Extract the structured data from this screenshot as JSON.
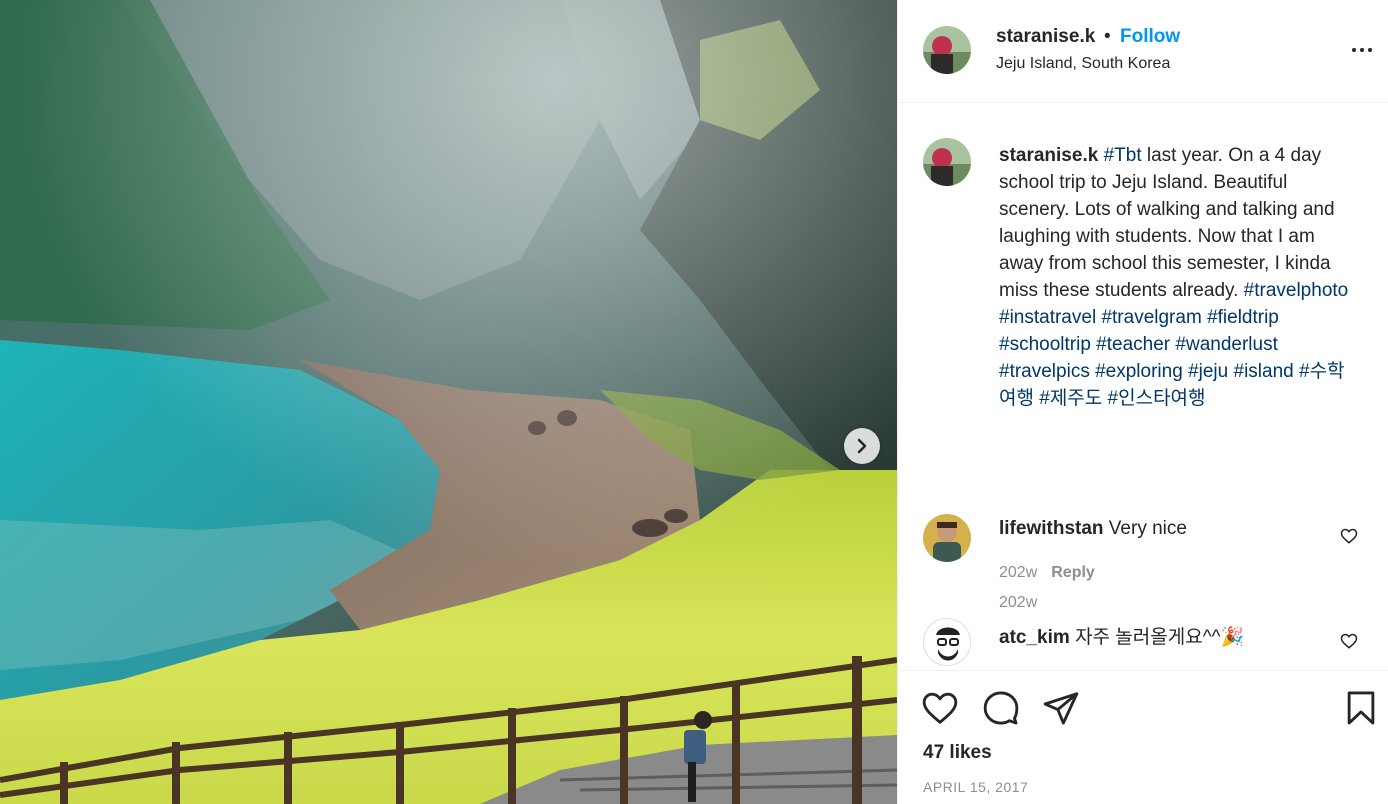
{
  "post": {
    "author": "staranise.k",
    "follow_label": "Follow",
    "separator": "•",
    "location": "Jeju Island, South Korea",
    "caption": {
      "author": "staranise.k",
      "tag_tbt": "#Tbt",
      "text": " last year. On a 4 day school trip to Jeju Island. Beautiful scenery. Lots of walking and talking and laughing with students. Now that I am away from school this semester, I kinda miss these students already.",
      "hashtags": [
        "#travelphoto",
        "#instatravel",
        "#travelgram",
        "#fieldtrip",
        "#schooltrip",
        "#teacher",
        "#wanderlust",
        "#travelpics",
        "#exploring",
        "#jeju",
        "#island",
        "#수학여행",
        "#제주도",
        "#인스타여행"
      ],
      "time": "202w"
    },
    "comments": [
      {
        "user": "lifewithstan",
        "text": "Very nice",
        "time": "202w",
        "reply_label": "Reply"
      },
      {
        "user": "atc_kim",
        "text": "자주 놀러올게요^^🎉"
      }
    ],
    "likes": "47 likes",
    "date": "APRIL 15, 2017"
  },
  "icons": {
    "next": "chevron-right-icon",
    "more": "more-options-icon",
    "like": "heart-icon",
    "comment": "comment-icon",
    "share": "share-icon",
    "save": "bookmark-icon"
  },
  "colors": {
    "follow": "#0095f6",
    "hashtag": "#00376b",
    "muted": "#8e8e8e",
    "text": "#262626"
  }
}
